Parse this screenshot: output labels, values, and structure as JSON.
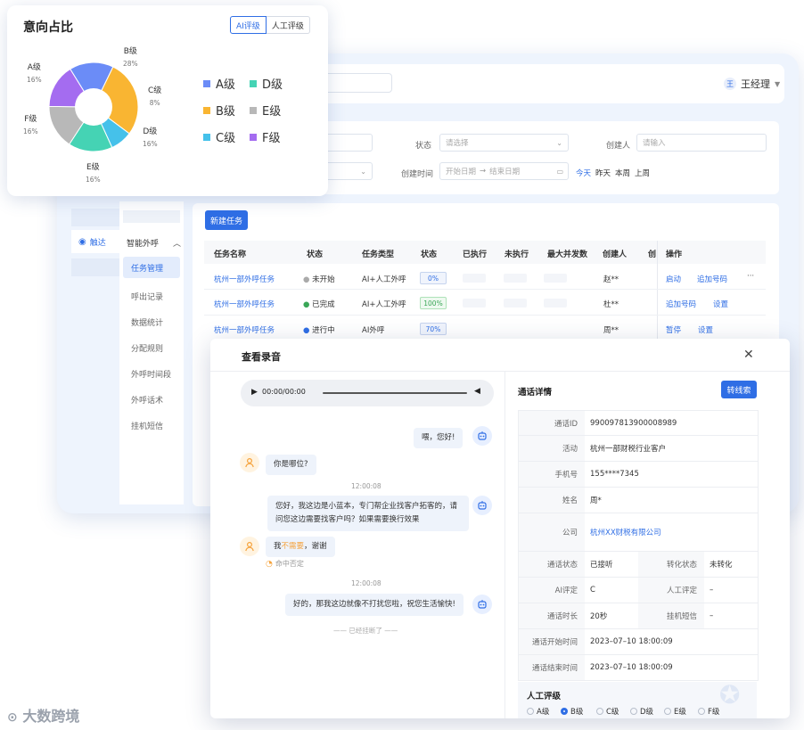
{
  "topbar": {
    "user": "王经理",
    "user_initial": "王"
  },
  "filters": {
    "status_label": "状态",
    "status_placeholder": "请选择",
    "creator_label": "创建人",
    "creator_placeholder": "请输入",
    "time_label": "创建时间",
    "start_placeholder": "开始日期",
    "range_sep": "→",
    "end_placeholder": "结束日期",
    "quick": [
      "今天",
      "昨天",
      "本周",
      "上周"
    ]
  },
  "nav": {
    "reach": "触达",
    "group": "智能外呼",
    "items": [
      "任务管理",
      "呼出记录",
      "数据统计",
      "分配规则",
      "外呼时间段",
      "外呼话术",
      "挂机短信"
    ]
  },
  "task": {
    "new_button": "新建任务",
    "headers": [
      "任务名称",
      "状态",
      "任务类型",
      "状态",
      "已执行",
      "未执行",
      "最大并发数",
      "创建人",
      "创",
      "操作"
    ],
    "rows": [
      {
        "name": "杭州一部外呼任务",
        "status": "未开始",
        "type": "AI+人工外呼",
        "progress": "0%",
        "creator": "赵**",
        "actions": [
          "启动",
          "追加号码",
          "···"
        ]
      },
      {
        "name": "杭州一部外呼任务",
        "status": "已完成",
        "type": "AI+人工外呼",
        "progress": "100%",
        "creator": "杜**",
        "actions": [
          "追加号码",
          "设置"
        ]
      },
      {
        "name": "杭州一部外呼任务",
        "status": "进行中",
        "type": "AI外呼",
        "progress": "70%",
        "creator": "周**",
        "actions": [
          "暂停",
          "设置"
        ]
      }
    ]
  },
  "pie": {
    "title": "意向占比",
    "toggle": [
      "AI评级",
      "人工评级"
    ],
    "colors": {
      "A": "#6b8cf7",
      "B": "#f9b532",
      "C": "#45c1ea",
      "D": "#45d3b4",
      "E": "#b8b8b8",
      "F": "#a46cf0"
    },
    "chart_data": {
      "type": "pie",
      "categories": [
        "A级",
        "B级",
        "C级",
        "D级",
        "E级",
        "F级"
      ],
      "values": [
        16,
        28,
        8,
        16,
        16,
        16
      ],
      "labels": [
        "16%",
        "28%",
        "8%",
        "16%",
        "16%",
        "16%"
      ],
      "legend": [
        "A级",
        "B级",
        "C级",
        "D级",
        "E级",
        "F级"
      ]
    }
  },
  "modal": {
    "title": "查看录音",
    "player_time": "00:00/00:00",
    "chat": [
      {
        "from": "bot",
        "text": "喂，您好!"
      },
      {
        "from": "human",
        "text": "你是哪位?"
      },
      {
        "time": "12:00:08"
      },
      {
        "from": "bot",
        "text": "您好，我这边是小蓝本，专门帮企业找客户拓客的，请问您这边需要找客户吗？如果需要换行效果"
      },
      {
        "from": "human",
        "text_pre": "我",
        "text_hl": "不需要",
        "text_post": "，谢谢",
        "hint": "命中否定"
      },
      {
        "time": "12:00:08"
      },
      {
        "from": "bot",
        "text": "好的，那我这边就像不打扰您啦，祝您生活愉快!"
      }
    ],
    "hangup": "—— 已经挂断了 ——",
    "detail_title": "通话详情",
    "transfer_button": "转线索",
    "details": {
      "call_id_k": "通话ID",
      "call_id_v": "990097813900008989",
      "activity_k": "活动",
      "activity_v": "杭州一部财税行业客户",
      "phone_k": "手机号",
      "phone_v": "155****7345",
      "name_k": "姓名",
      "name_v": "周*",
      "company_k": "公司",
      "company_v": "杭州XX财税有限公司",
      "call_status_k": "通话状态",
      "call_status_v": "已接听",
      "convert_k": "转化状态",
      "convert_v": "未转化",
      "ai_rate_k": "AI评定",
      "ai_rate_v": "C",
      "manual_k": "人工评定",
      "manual_v": "–",
      "duration_k": "通话时长",
      "duration_v": "20秒",
      "sms_k": "挂机短信",
      "sms_v": "–",
      "start_k": "通话开始时间",
      "start_v": "2023–07–10 18:00:09",
      "end_k": "通话结束时间",
      "end_v": "2023–07–10 18:00:09"
    },
    "rating_title": "人工评级",
    "rating_options": [
      "A级",
      "B级",
      "C级",
      "D级",
      "E级",
      "F级"
    ],
    "rating_selected": "B级"
  },
  "watermark": "大数跨境"
}
